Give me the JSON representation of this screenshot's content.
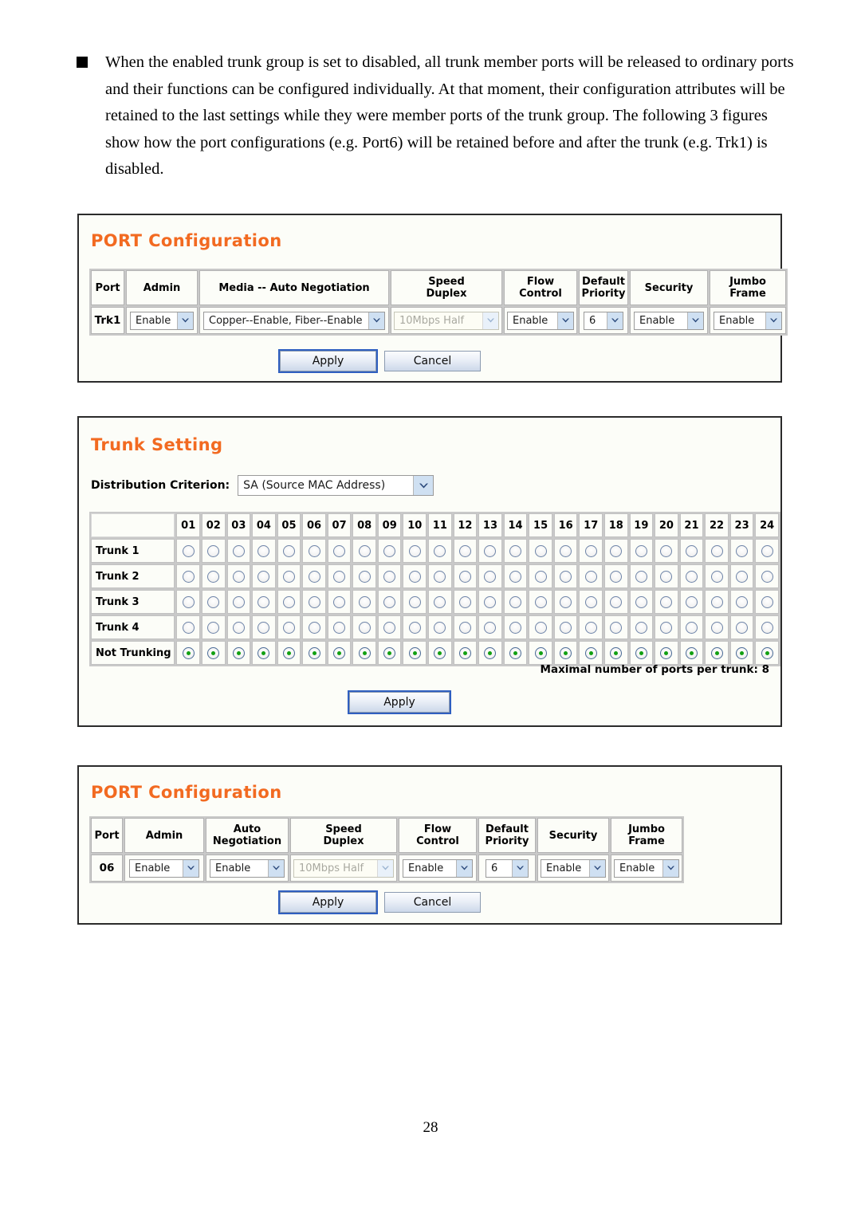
{
  "document": {
    "page_number": "28",
    "intro_paragraph": "When the enabled trunk group is set to disabled, all trunk member ports will be released to ordinary ports and their functions can be configured individually. At that moment, their configuration attributes will be retained to the last settings while they were member ports of the trunk group. The following 3 figures show how the port configurations (e.g. Port6) will be retained before and after the trunk (e.g. Trk1) is disabled."
  },
  "colors": {
    "panel_title": "#f26a21",
    "panel_border": "#2b2b2b",
    "panel_background": "#fcfdf8",
    "radio_selected_dot": "#12a012",
    "select_arrow_button": "#cfe0f2",
    "button_focus_outline": "#2f5fc0"
  },
  "panel_port_config_trunk": {
    "title": "PORT Configuration",
    "columns": [
      {
        "label": "Port"
      },
      {
        "label": "Admin"
      },
      {
        "label": "Media -- Auto Negotiation"
      },
      {
        "label_line1": "Speed",
        "label_line2": "Duplex"
      },
      {
        "label_line1": "Flow",
        "label_line2": "Control"
      },
      {
        "label_line1": "Default",
        "label_line2": "Priority"
      },
      {
        "label": "Security"
      },
      {
        "label_line1": "Jumbo",
        "label_line2": "Frame"
      }
    ],
    "row": {
      "port": "Trk1",
      "admin": "Enable",
      "media_auto_negotiation": "Copper--Enable, Fiber--Enable",
      "speed_duplex": "10Mbps Half",
      "speed_duplex_disabled": true,
      "flow_control": "Enable",
      "default_priority": "6",
      "security": "Enable",
      "jumbo_frame": "Enable"
    },
    "buttons": {
      "apply": "Apply",
      "cancel": "Cancel"
    }
  },
  "panel_trunk_setting": {
    "title": "Trunk Setting",
    "distribution_criterion_label": "Distribution Criterion:",
    "distribution_criterion_value": "SA (Source MAC Address)",
    "port_numbers": [
      "01",
      "02",
      "03",
      "04",
      "05",
      "06",
      "07",
      "08",
      "09",
      "10",
      "11",
      "12",
      "13",
      "14",
      "15",
      "16",
      "17",
      "18",
      "19",
      "20",
      "21",
      "22",
      "23",
      "24"
    ],
    "rows": [
      {
        "label": "Trunk 1",
        "selected_ports": []
      },
      {
        "label": "Trunk 2",
        "selected_ports": []
      },
      {
        "label": "Trunk 3",
        "selected_ports": []
      },
      {
        "label": "Trunk 4",
        "selected_ports": []
      },
      {
        "label": "Not Trunking",
        "selected_ports": [
          "01",
          "02",
          "03",
          "04",
          "05",
          "06",
          "07",
          "08",
          "09",
          "10",
          "11",
          "12",
          "13",
          "14",
          "15",
          "16",
          "17",
          "18",
          "19",
          "20",
          "21",
          "22",
          "23",
          "24"
        ]
      }
    ],
    "maximal_note": "Maximal number of ports per trunk: 8",
    "buttons": {
      "apply": "Apply"
    }
  },
  "panel_port_config_port": {
    "title": "PORT Configuration",
    "columns": [
      {
        "label": "Port"
      },
      {
        "label": "Admin"
      },
      {
        "label_line1": "Auto",
        "label_line2": "Negotiation"
      },
      {
        "label_line1": "Speed",
        "label_line2": "Duplex"
      },
      {
        "label_line1": "Flow",
        "label_line2": "Control"
      },
      {
        "label_line1": "Default",
        "label_line2": "Priority"
      },
      {
        "label": "Security"
      },
      {
        "label_line1": "Jumbo",
        "label_line2": "Frame"
      }
    ],
    "row": {
      "port": "06",
      "admin": "Enable",
      "auto_negotiation": "Enable",
      "speed_duplex": "10Mbps Half",
      "speed_duplex_disabled": true,
      "flow_control": "Enable",
      "default_priority": "6",
      "security": "Enable",
      "jumbo_frame": "Enable"
    },
    "buttons": {
      "apply": "Apply",
      "cancel": "Cancel"
    }
  }
}
